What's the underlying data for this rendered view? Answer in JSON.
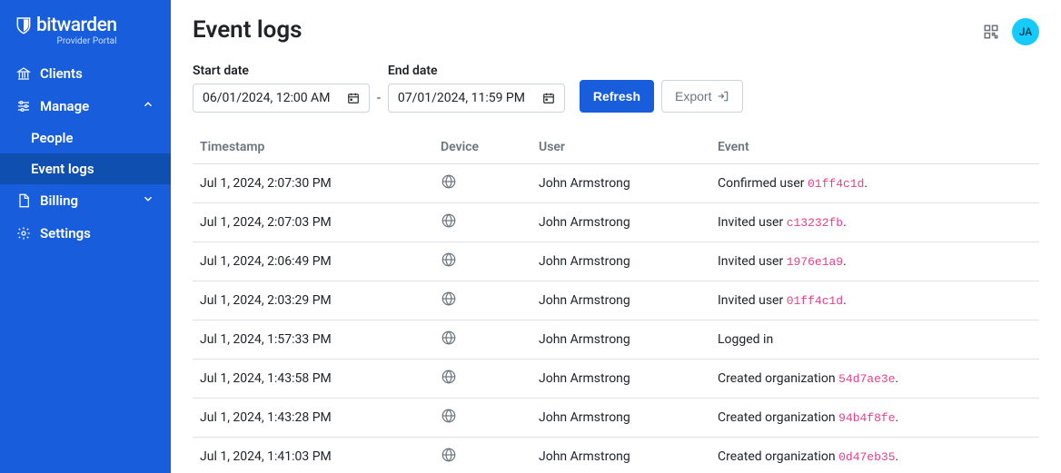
{
  "brand": {
    "name": "bitwarden",
    "subtitle": "Provider Portal"
  },
  "sidebar": {
    "items": [
      {
        "label": "Clients"
      },
      {
        "label": "Manage"
      },
      {
        "label": "Billing"
      },
      {
        "label": "Settings"
      }
    ],
    "manage_children": [
      {
        "label": "People"
      },
      {
        "label": "Event logs"
      }
    ]
  },
  "header": {
    "avatar_initials": "JA"
  },
  "page": {
    "title": "Event logs"
  },
  "filters": {
    "start_label": "Start date",
    "start_value": "06/01/2024, 12:00 AM",
    "end_label": "End date",
    "end_value": "07/01/2024, 11:59 PM",
    "refresh_label": "Refresh",
    "export_label": "Export",
    "dash": "-"
  },
  "table": {
    "columns": {
      "timestamp": "Timestamp",
      "device": "Device",
      "user": "User",
      "event": "Event"
    },
    "rows": [
      {
        "timestamp": "Jul 1, 2024, 2:07:30 PM",
        "user": "John Armstrong",
        "event_prefix": "Confirmed user ",
        "event_code": "01ff4c1d",
        "event_suffix": "."
      },
      {
        "timestamp": "Jul 1, 2024, 2:07:03 PM",
        "user": "John Armstrong",
        "event_prefix": "Invited user ",
        "event_code": "c13232fb",
        "event_suffix": "."
      },
      {
        "timestamp": "Jul 1, 2024, 2:06:49 PM",
        "user": "John Armstrong",
        "event_prefix": "Invited user ",
        "event_code": "1976e1a9",
        "event_suffix": "."
      },
      {
        "timestamp": "Jul 1, 2024, 2:03:29 PM",
        "user": "John Armstrong",
        "event_prefix": "Invited user ",
        "event_code": "01ff4c1d",
        "event_suffix": "."
      },
      {
        "timestamp": "Jul 1, 2024, 1:57:33 PM",
        "user": "John Armstrong",
        "event_prefix": "Logged in",
        "event_code": "",
        "event_suffix": ""
      },
      {
        "timestamp": "Jul 1, 2024, 1:43:58 PM",
        "user": "John Armstrong",
        "event_prefix": "Created organization ",
        "event_code": "54d7ae3e",
        "event_suffix": "."
      },
      {
        "timestamp": "Jul 1, 2024, 1:43:28 PM",
        "user": "John Armstrong",
        "event_prefix": "Created organization ",
        "event_code": "94b4f8fe",
        "event_suffix": "."
      },
      {
        "timestamp": "Jul 1, 2024, 1:41:03 PM",
        "user": "John Armstrong",
        "event_prefix": "Created organization ",
        "event_code": "0d47eb35",
        "event_suffix": "."
      }
    ]
  }
}
